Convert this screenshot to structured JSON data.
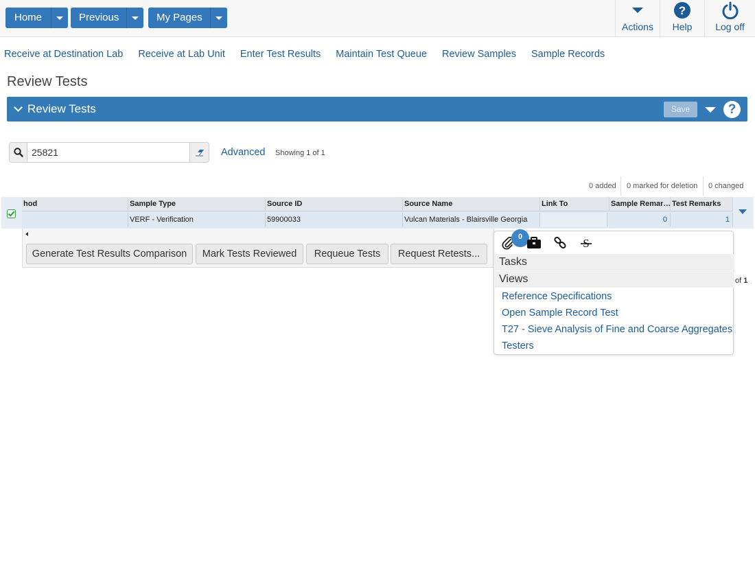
{
  "topbar": {
    "home_label": "Home",
    "previous_label": "Previous",
    "mypages_label": "My Pages",
    "actions_label": "Actions",
    "help_label": "Help",
    "logoff_label": "Log off"
  },
  "quick_links": [
    "Receive at Destination Lab",
    "Receive at Lab Unit",
    "Enter Test Results",
    "Maintain Test Queue",
    "Review Samples",
    "Sample Records"
  ],
  "page_title": "Review Tests",
  "panel": {
    "title": "Review Tests",
    "save_label": "Save"
  },
  "search": {
    "value": "25821",
    "advanced_label": "Advanced",
    "showing": "Showing 1 of 1"
  },
  "counters": {
    "added": "0 added",
    "marked_for_deletion": "0 marked for deletion",
    "changed": "0 changed"
  },
  "grid": {
    "columns": [
      "hod",
      "Sample Type",
      "Source ID",
      "Source Name",
      "Link To",
      "Sample Remar…",
      "Test Remarks"
    ],
    "row": [
      "",
      "VERF - Verification",
      "59900033",
      "Vulcan Materials - Blairsville Georgia",
      "",
      "0",
      "1"
    ]
  },
  "actions": {
    "generate": "Generate Test Results Comparison",
    "mark_reviewed": "Mark Tests Reviewed",
    "requeue": "Requeue Tests",
    "request_retests": "Request Retests..."
  },
  "pager": {
    "of_label": "of",
    "total": "1"
  },
  "popup": {
    "attachment_count": "0",
    "tasks_label": "Tasks",
    "views_label": "Views",
    "views": [
      "Reference Specifications",
      "Open Sample Record Test",
      "T27 - Sieve Analysis of Fine and Coarse Aggregates",
      "Testers"
    ]
  },
  "colors": {
    "primary_blue": "#337ab7",
    "link_blue": "#1d5c99",
    "check_green": "#2e9e3e"
  }
}
